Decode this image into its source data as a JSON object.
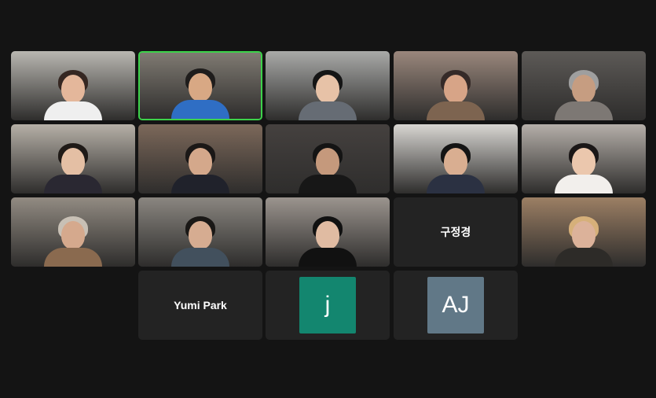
{
  "meeting": {
    "tiles": [
      {
        "type": "video",
        "bg": "#b9b7b1",
        "skin": "#e4b79b",
        "hair": "#352722",
        "shirt": "#efefef"
      },
      {
        "type": "video",
        "bg": "#7f7a72",
        "skin": "#d8a884",
        "hair": "#1f1d1c",
        "shirt": "#2f6ec4",
        "active": true
      },
      {
        "type": "video",
        "bg": "#a9aaa8",
        "skin": "#e7c2a7",
        "hair": "#151515",
        "shirt": "#666c74"
      },
      {
        "type": "video",
        "bg": "#9a877c",
        "skin": "#d7a487",
        "hair": "#352a28",
        "shirt": "#7d6450"
      },
      {
        "type": "video",
        "bg": "#5d5a57",
        "skin": "#c69d81",
        "hair": "#9f9f9f",
        "shirt": "#7d7874"
      },
      {
        "type": "video",
        "bg": "#b6b0a7",
        "skin": "#e4bfa4",
        "hair": "#1f1a17",
        "shirt": "#2a2832"
      },
      {
        "type": "video",
        "bg": "#7c685a",
        "skin": "#d4a88b",
        "hair": "#1b1817",
        "shirt": "#20222b"
      },
      {
        "type": "video",
        "bg": "#45413f",
        "skin": "#c5997c",
        "hair": "#141414",
        "shirt": "#171717"
      },
      {
        "type": "video",
        "bg": "#d8d6d2",
        "skin": "#d9ae91",
        "hair": "#141414",
        "shirt": "#2b3142"
      },
      {
        "type": "video",
        "bg": "#b5afa9",
        "skin": "#ebc7ad",
        "hair": "#1b1717",
        "shirt": "#f2efec"
      },
      {
        "type": "video",
        "bg": "#928b82",
        "skin": "#d5a98d",
        "hair": "#c8c0b5",
        "shirt": "#8a6a4f"
      },
      {
        "type": "video",
        "bg": "#8a8680",
        "skin": "#d6ac91",
        "hair": "#1a1816",
        "shirt": "#42505d"
      },
      {
        "type": "video",
        "bg": "#9b948e",
        "skin": "#e0bba2",
        "hair": "#111111",
        "shirt": "#111111"
      },
      {
        "type": "name",
        "name": "구정경"
      },
      {
        "type": "video",
        "bg": "#9c7f64",
        "skin": "#dcb29a",
        "hair": "#d6b07a",
        "shirt": "#2d2b28"
      },
      {
        "type": "name",
        "name": "Yumi Park"
      },
      {
        "type": "avatar",
        "initials": "j",
        "color": "#13866f"
      },
      {
        "type": "avatar",
        "initials": "AJ",
        "color": "#617887"
      }
    ]
  }
}
